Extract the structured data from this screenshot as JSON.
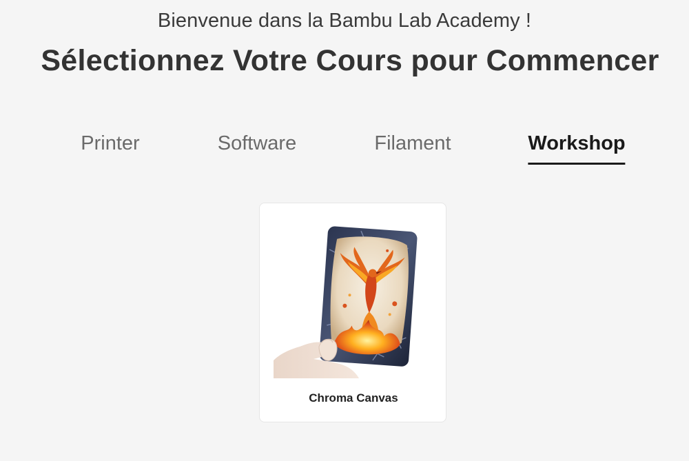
{
  "header": {
    "subtitle": "Bienvenue dans la Bambu Lab Academy !",
    "title": "Sélectionnez Votre Cours pour Commencer"
  },
  "tabs": [
    {
      "label": "Printer",
      "active": false
    },
    {
      "label": "Software",
      "active": false
    },
    {
      "label": "Filament",
      "active": false
    },
    {
      "label": "Workshop",
      "active": true
    }
  ],
  "courses": [
    {
      "title": "Chroma Canvas",
      "image_icon": "phoenix-card-image"
    }
  ],
  "colors": {
    "background": "#f5f5f5",
    "active_tab": "#1a1a1a",
    "inactive_tab": "#6a6a6a",
    "card_background": "#ffffff"
  }
}
